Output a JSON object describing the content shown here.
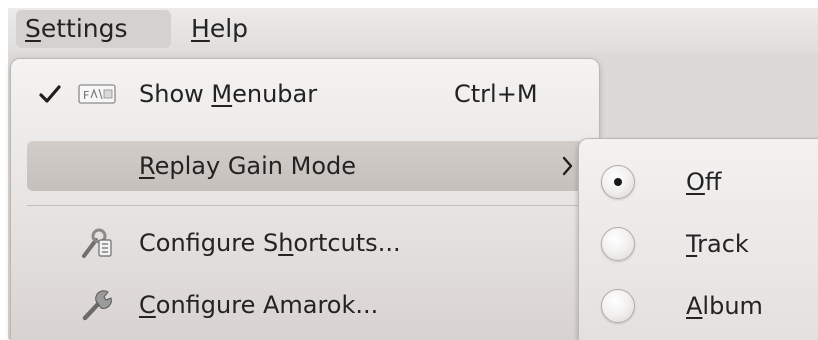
{
  "menubar": {
    "items": [
      {
        "mnemonic": "S",
        "rest": "ettings"
      },
      {
        "mnemonic": "H",
        "rest": "elp"
      }
    ]
  },
  "settings_menu": {
    "show_menubar": {
      "pre": "Show ",
      "mnemonic": "M",
      "post": "enubar",
      "shortcut": "Ctrl+M",
      "checked": true,
      "icon": "menubar-icon"
    },
    "replay_gain": {
      "pre": "",
      "mnemonic": "R",
      "post": "eplay Gain Mode",
      "submenu_arrow": "›"
    },
    "configure_shortcuts": {
      "pre": "Configure S",
      "mnemonic": "h",
      "post": "ortcuts...",
      "icon": "configure-shortcuts-icon"
    },
    "configure_amarok": {
      "pre": "",
      "mnemonic": "C",
      "post": "onfigure Amarok...",
      "icon": "wrench-icon"
    }
  },
  "replay_gain_submenu": {
    "selected": "off",
    "options": [
      {
        "id": "off",
        "mnemonic": "O",
        "rest": "ff"
      },
      {
        "id": "track",
        "mnemonic": "T",
        "rest": "rack"
      },
      {
        "id": "album",
        "mnemonic": "A",
        "rest": "lbum"
      }
    ]
  }
}
